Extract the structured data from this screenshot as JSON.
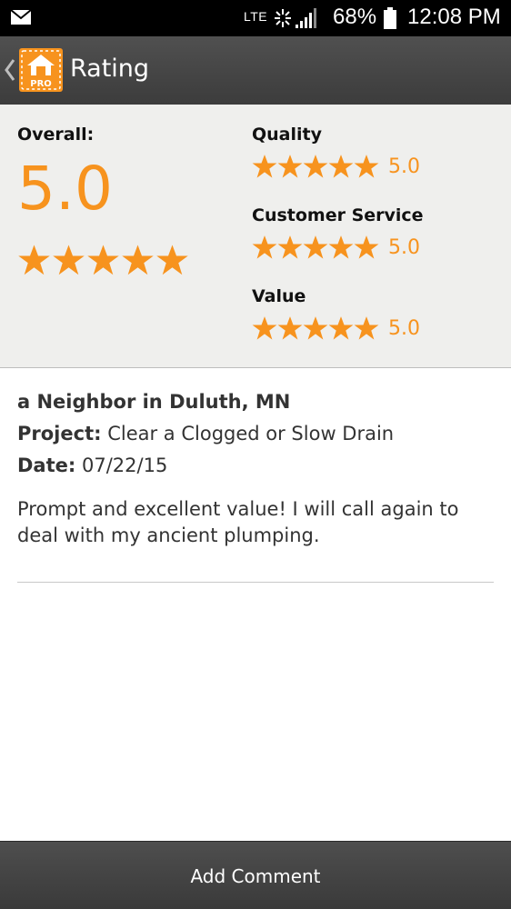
{
  "status_bar": {
    "network": "LTE",
    "battery_percent": "68%",
    "time": "12:08 PM",
    "icons": [
      "mail-icon",
      "data-activity-icon",
      "signal-icon",
      "battery-icon"
    ]
  },
  "action_bar": {
    "title": "Rating",
    "logo_badge": "PRO",
    "icons": [
      "back-chevron-icon",
      "app-logo-icon"
    ]
  },
  "ratings": {
    "overall_label": "Overall:",
    "overall_score": "5.0",
    "overall_stars": 5,
    "categories": [
      {
        "label": "Quality",
        "value": "5.0",
        "stars": 5
      },
      {
        "label": "Customer Service",
        "value": "5.0",
        "stars": 5
      },
      {
        "label": "Value",
        "value": "5.0",
        "stars": 5
      }
    ]
  },
  "review": {
    "reviewer": "a Neighbor in Duluth, MN",
    "project_label": "Project:",
    "project_value": "Clear a Clogged or Slow Drain",
    "date_label": "Date:",
    "date_value": "07/22/15",
    "text": "Prompt and excellent value!  I will call again to deal with my ancient plumping."
  },
  "bottom": {
    "add_comment_label": "Add Comment"
  },
  "colors": {
    "accent": "#f7931e",
    "bar": "#444444",
    "panel": "#efefed"
  }
}
